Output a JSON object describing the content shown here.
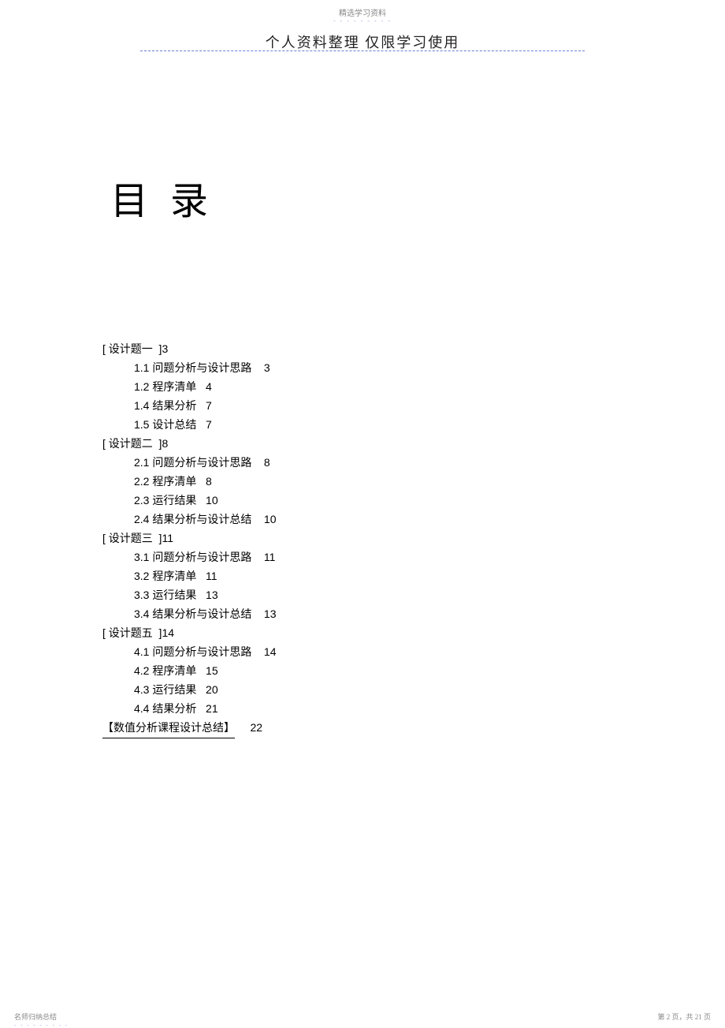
{
  "top_label": "精选学习资料",
  "header": "个人资料整理   仅限学习使用",
  "title": "目 录",
  "toc": {
    "sections": [
      {
        "heading": "[ 设计题一  ]3",
        "items": [
          {
            "label": "1.1 问题分析与设计思路",
            "page": "3"
          },
          {
            "label": "1.2 程序清单",
            "page": "4"
          },
          {
            "label": "1.4 结果分析",
            "page": "7"
          },
          {
            "label": "1.5 设计总结",
            "page": "7"
          }
        ]
      },
      {
        "heading": "[ 设计题二  ]8",
        "items": [
          {
            "label": "2.1 问题分析与设计思路",
            "page": "8"
          },
          {
            "label": "2.2 程序清单",
            "page": "8"
          },
          {
            "label": "2.3 运行结果",
            "page": "10"
          },
          {
            "label": "2.4 结果分析与设计总结",
            "page": "10"
          }
        ]
      },
      {
        "heading": "[ 设计题三  ]11",
        "items": [
          {
            "label": "3.1 问题分析与设计思路",
            "page": "11"
          },
          {
            "label": "3.2 程序清单",
            "page": "11"
          },
          {
            "label": "3.3 运行结果",
            "page": "13"
          },
          {
            "label": "3.4 结果分析与设计总结",
            "page": "13"
          }
        ]
      },
      {
        "heading": "[ 设计题五  ]14",
        "items": [
          {
            "label": "4.1 问题分析与设计思路",
            "page": "14"
          },
          {
            "label": "4.2 程序清单",
            "page": "15"
          },
          {
            "label": "4.3 运行结果",
            "page": "20"
          },
          {
            "label": "4.4 结果分析",
            "page": "21"
          }
        ]
      }
    ],
    "summary": {
      "label": "【数值分析课程设计总结】",
      "page": "22"
    }
  },
  "footer": {
    "left": "名师归纳总结",
    "right": "第 2 页，共 21 页"
  }
}
